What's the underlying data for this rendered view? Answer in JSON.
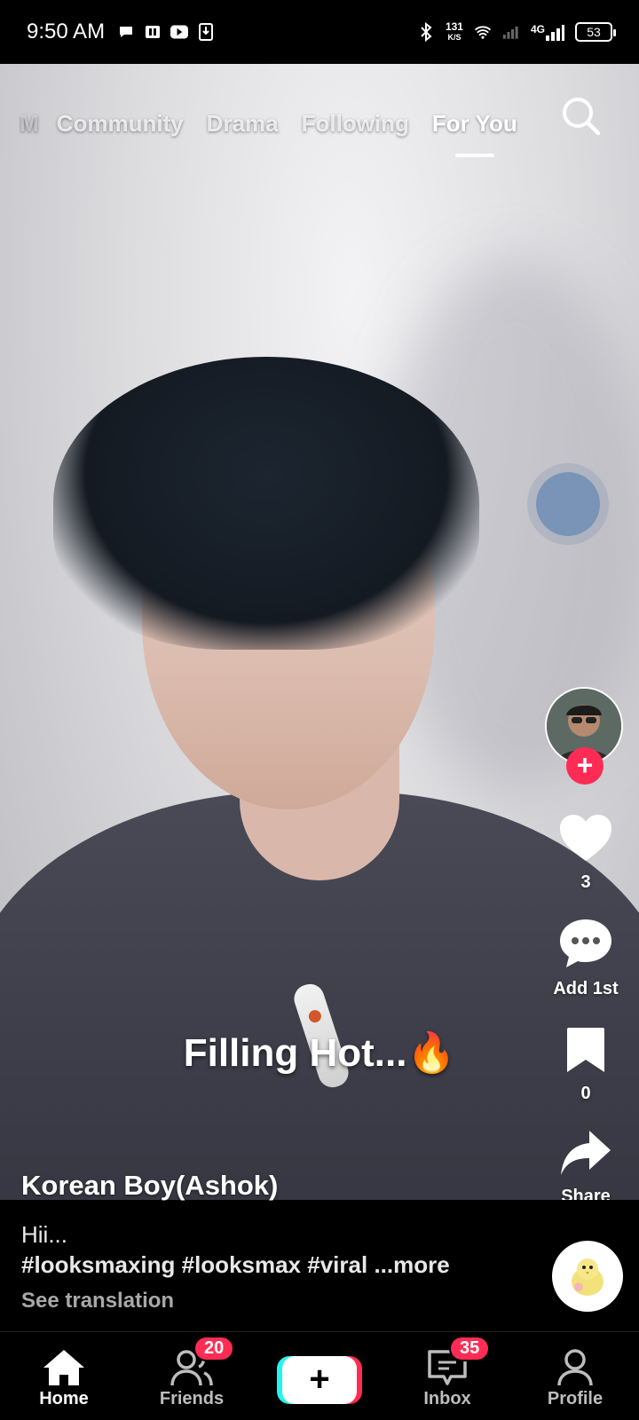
{
  "status_bar": {
    "time": "9:50 AM",
    "net_speed_value": "131",
    "net_speed_unit": "K/S",
    "network": "4G",
    "battery": "53"
  },
  "top_tabs": {
    "partial": "M",
    "items": [
      "Community",
      "Drama",
      "Following",
      "For You"
    ],
    "active": "For You"
  },
  "video": {
    "overlay_caption": "Filling Hot...🔥"
  },
  "rail": {
    "likes": "3",
    "comments": "Add 1st",
    "saves": "0",
    "share": "Share"
  },
  "post": {
    "author": "Korean Boy(Ashok)",
    "text": "Hii...",
    "hashtags": "#looksmaxing #looksmax #viral",
    "more": "...more",
    "see_translation": "See translation"
  },
  "bottom_nav": {
    "home": "Home",
    "friends": "Friends",
    "friends_badge": "20",
    "create": "+",
    "inbox": "Inbox",
    "inbox_badge": "35",
    "profile": "Profile"
  },
  "colors": {
    "accent": "#fe2c55",
    "cyan": "#25f4ee"
  }
}
